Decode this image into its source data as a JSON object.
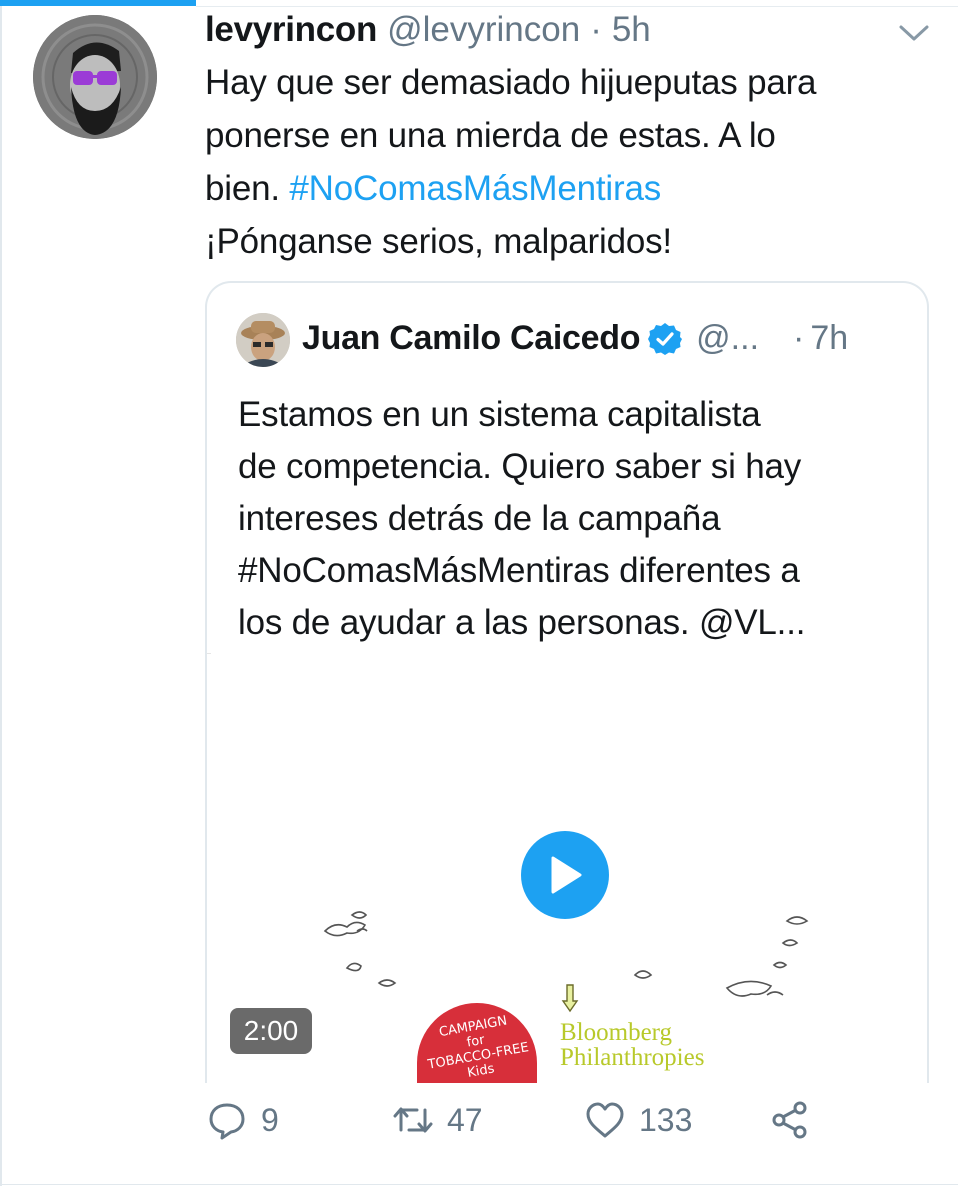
{
  "tweet": {
    "author_name": "levyrincon",
    "author_handle": "@levyrincon",
    "separator": "·",
    "time": "5h",
    "text_lines": [
      "Hay que ser demasiado hijueputas para",
      "ponerse en una mierda de estas. A lo"
    ],
    "text_line3_prefix": "bien. ",
    "hashtag": "#NoComasMásMentiras",
    "text_line4": "¡Pónganse serios, malparidos!"
  },
  "quoted_tweet": {
    "author_name": "Juan Camilo Caicedo",
    "author_handle": "@...",
    "separator": "·",
    "time": "7h",
    "text_lines": [
      "Estamos en un sistema capitalista",
      "de competencia. Quiero saber si hay",
      "intereses detrás de la campaña",
      "#NoComasMásMentiras diferentes a",
      "los de ayudar a las personas. @VL..."
    ],
    "media": {
      "duration": "2:00",
      "campaign_logo_text": "CAMPAIGN\nfor\nTOBACCO-FREE\nKids",
      "sponsor_lines": [
        "Bloomberg",
        "Philanthropies"
      ]
    }
  },
  "actions": {
    "replies": "9",
    "retweets": "47",
    "likes": "133"
  },
  "colors": {
    "accent": "#1da1f2",
    "muted_text": "#657786",
    "border": "#e1e8ed"
  },
  "icons": [
    "reply-icon",
    "retweet-icon",
    "like-icon",
    "share-icon",
    "chevron-down-icon",
    "verified-icon",
    "play-icon"
  ]
}
